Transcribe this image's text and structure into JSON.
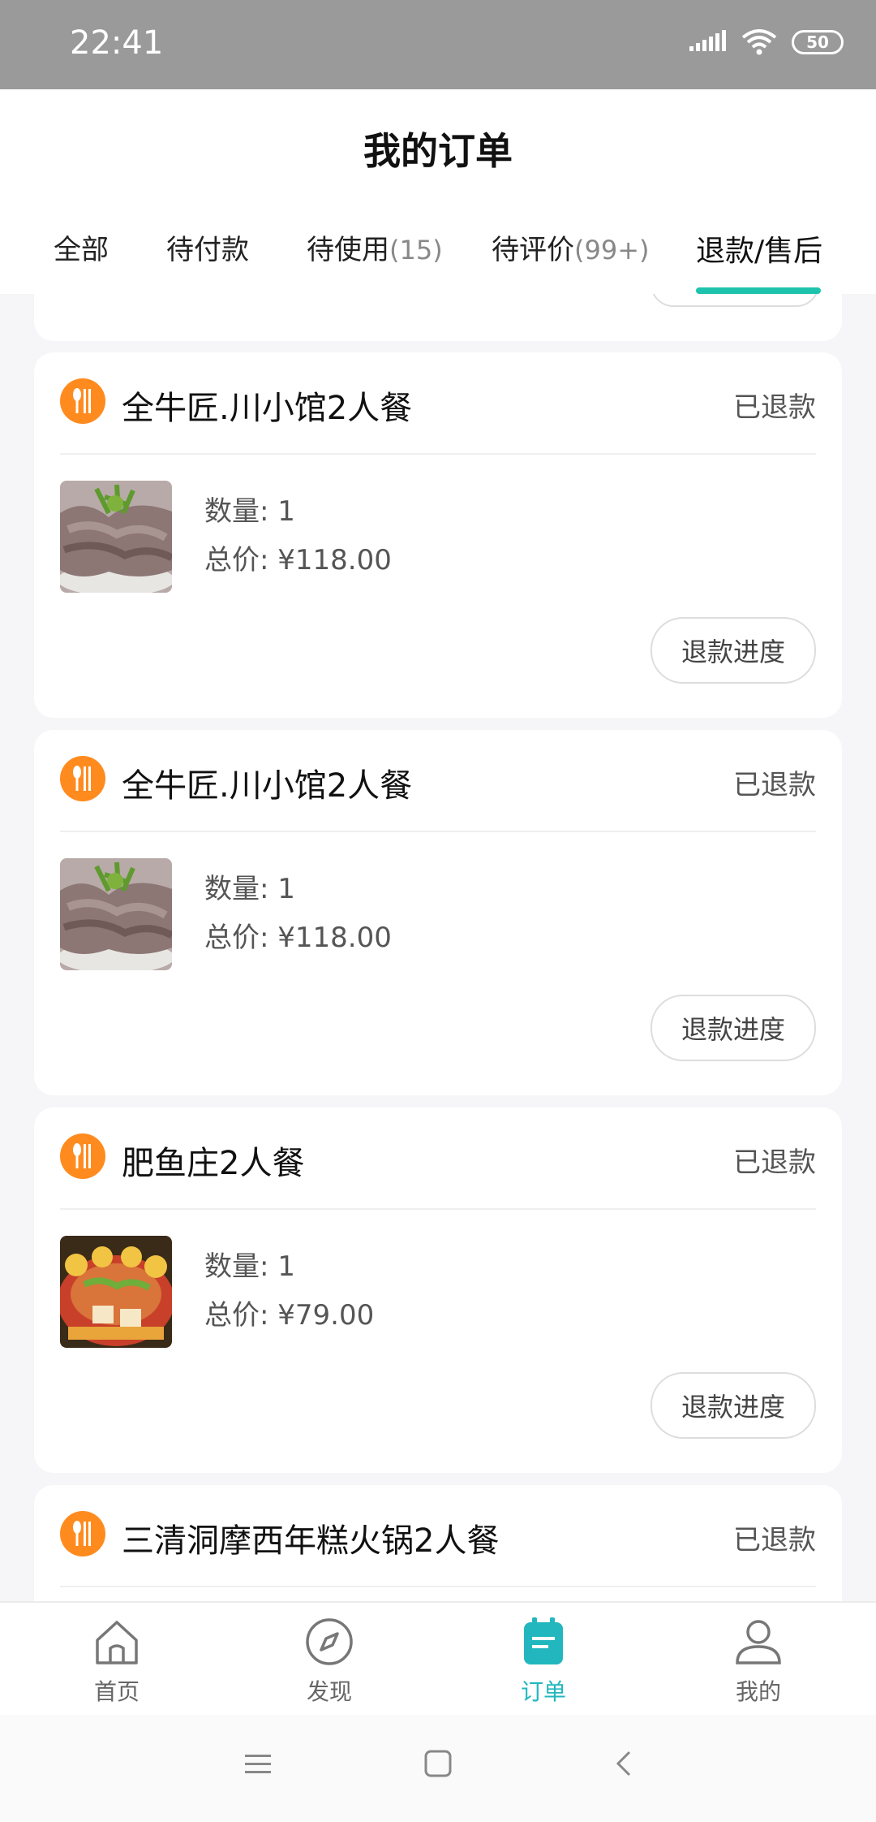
{
  "status_bar": {
    "time": "22:41",
    "battery": "50"
  },
  "header": {
    "title": "我的订单"
  },
  "tabs": [
    {
      "label": "全部",
      "count": ""
    },
    {
      "label": "待付款",
      "count": ""
    },
    {
      "label": "待使用",
      "count": "(15)"
    },
    {
      "label": "待评价",
      "count": "(99+)"
    },
    {
      "label": "退款/售后",
      "count": ""
    }
  ],
  "active_tab_index": 4,
  "orders": [
    {
      "shop": "全牛匠.川小馆2人餐",
      "status": "已退款",
      "quantity": "数量: 1",
      "total": "总价: ¥118.00",
      "action": "退款进度",
      "image": "beef-dish"
    },
    {
      "shop": "全牛匠.川小馆2人餐",
      "status": "已退款",
      "quantity": "数量: 1",
      "total": "总价: ¥118.00",
      "action": "退款进度",
      "image": "beef-dish"
    },
    {
      "shop": "肥鱼庄2人餐",
      "status": "已退款",
      "quantity": "数量: 1",
      "total": "总价: ¥79.00",
      "action": "退款进度",
      "image": "fish-hotpot"
    },
    {
      "shop": "三清洞摩西年糕火锅2人餐",
      "status": "已退款"
    }
  ],
  "bottom_nav": [
    {
      "label": "首页",
      "icon": "home-icon"
    },
    {
      "label": "发现",
      "icon": "compass-icon"
    },
    {
      "label": "订单",
      "icon": "order-clipboard-icon"
    },
    {
      "label": "我的",
      "icon": "user-icon"
    }
  ],
  "colors": {
    "accent": "#1ec3ad",
    "shop_icon": "#ff8b1f",
    "nav_active": "#22b7be"
  }
}
